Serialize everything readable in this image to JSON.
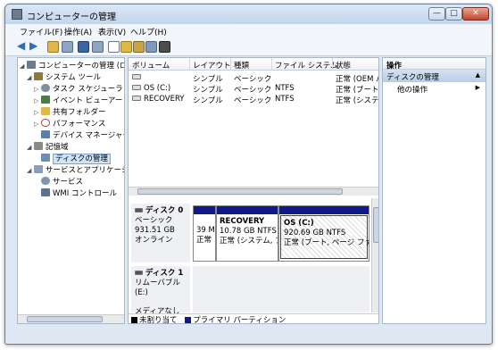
{
  "window": {
    "title": "コンピューターの管理"
  },
  "controls": {
    "minimize": "—",
    "maximize": "□",
    "close": "✕"
  },
  "menu": [
    "ファイル(F)",
    "操作(A)",
    "表示(V)",
    "ヘルプ(H)"
  ],
  "tree": {
    "items": [
      {
        "label": "コンピューターの管理 (ローカ",
        "icon": "computer-management-icon",
        "color": "#6b7b8d"
      },
      {
        "label": "システム ツール",
        "icon": "system-tools-icon",
        "color": "#8f7a3c"
      },
      {
        "label": "タスク スケジューラ",
        "icon": "task-scheduler-icon",
        "color": "#7f8f9f"
      },
      {
        "label": "イベント ビューアー",
        "icon": "event-viewer-icon",
        "color": "#4a7f44"
      },
      {
        "label": "共有フォルダー",
        "icon": "shared-folder-icon",
        "color": "#e1b746"
      },
      {
        "label": "パフォーマンス",
        "icon": "performance-icon",
        "color": "#c0392b"
      },
      {
        "label": "デバイス マネージャー",
        "icon": "device-manager-icon",
        "color": "#5b7fa8"
      },
      {
        "label": "記憶域",
        "icon": "storage-icon",
        "color": "#8a8a8a"
      },
      {
        "label": "ディスクの管理",
        "icon": "disk-management-icon",
        "color": "#6d8db3"
      },
      {
        "label": "サービスとアプリケーション",
        "icon": "services-apps-icon",
        "color": "#8aa0b8"
      },
      {
        "label": "サービス",
        "icon": "services-icon",
        "color": "#7f96b0"
      },
      {
        "label": "WMI コントロール",
        "icon": "wmi-control-icon",
        "color": "#5e7390"
      }
    ]
  },
  "volumes": {
    "headers": [
      "ボリューム",
      "レイアウト",
      "種類",
      "ファイル システム",
      "状態"
    ],
    "rows": [
      [
        "",
        "シンプル",
        "ベーシック",
        "",
        "正常 (OEM パ"
      ],
      [
        "OS (C:)",
        "シンプル",
        "ベーシック",
        "NTFS",
        "正常 (ブート, "
      ],
      [
        "RECOVERY",
        "シンプル",
        "ベーシック",
        "NTFS",
        "正常 (システム"
      ]
    ]
  },
  "disk0": {
    "name": "ディスク 0",
    "type": "ベーシック",
    "size": "931.51 GB",
    "status": "オンライン",
    "partitions": [
      {
        "name": "",
        "size": "39 M",
        "status": "正常"
      },
      {
        "name": "RECOVERY",
        "size": "10.78 GB NTFS",
        "status": "正常 (システム, ア"
      },
      {
        "name": "OS (C:)",
        "size": "920.69 GB NTFS",
        "status": "正常 (ブート, ページ ファイ"
      }
    ]
  },
  "disk1": {
    "name": "ディスク 1",
    "type": "リムーバブル (E:)",
    "status": "メディアなし"
  },
  "legend": [
    {
      "label": "未割り当て",
      "color": "#000000"
    },
    {
      "label": "プライマリ パーティション",
      "color": "#0f1a86"
    }
  ],
  "actions": {
    "header": "操作",
    "section": "ディスクの管理",
    "item": "他の操作"
  }
}
